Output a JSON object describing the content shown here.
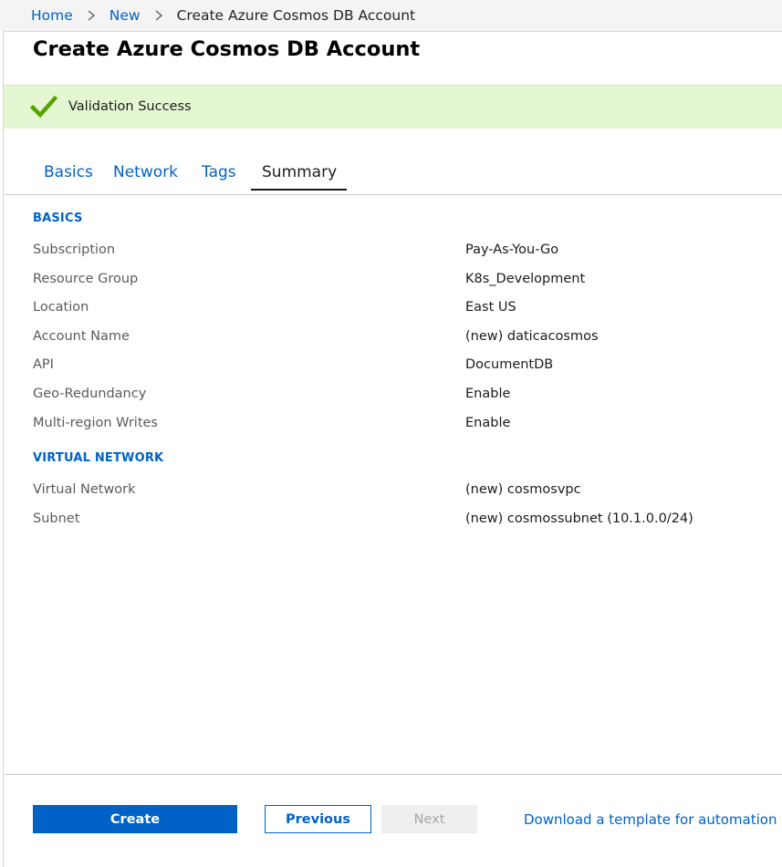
{
  "breadcrumb": {
    "items": [
      "Home",
      "New"
    ],
    "current": "Create Azure Cosmos DB Account"
  },
  "page": {
    "title": "Create Azure Cosmos DB Account"
  },
  "validation": {
    "message": "Validation Success",
    "color": "#57a300"
  },
  "tabs": [
    {
      "label": "Basics",
      "active": false
    },
    {
      "label": "Network",
      "active": false
    },
    {
      "label": "Tags",
      "active": false
    },
    {
      "label": "Summary",
      "active": true
    }
  ],
  "summary": {
    "basics": {
      "heading": "BASICS",
      "rows": [
        {
          "label": "Subscription",
          "value": "Pay-As-You-Go"
        },
        {
          "label": "Resource Group",
          "value": "K8s_Development"
        },
        {
          "label": "Location",
          "value": "East US"
        },
        {
          "label": "Account Name",
          "value": "(new) daticacosmos"
        },
        {
          "label": "API",
          "value": "DocumentDB"
        },
        {
          "label": "Geo-Redundancy",
          "value": "Enable"
        },
        {
          "label": "Multi-region Writes",
          "value": "Enable"
        }
      ]
    },
    "virtual_network": {
      "heading": "VIRTUAL NETWORK",
      "rows": [
        {
          "label": "Virtual Network",
          "value": "(new) cosmosvpc"
        },
        {
          "label": "Subnet",
          "value": "(new) cosmossubnet (10.1.0.0/24)"
        }
      ]
    }
  },
  "footer": {
    "create_label": "Create",
    "previous_label": "Previous",
    "next_label": "Next",
    "download_label": "Download a template for automation"
  },
  "colors": {
    "accent": "#0062c7",
    "success_bg": "#e5f6d3"
  }
}
